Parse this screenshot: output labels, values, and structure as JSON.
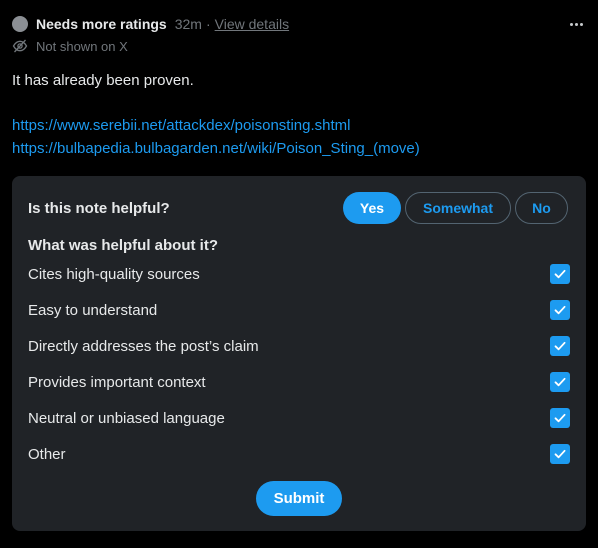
{
  "header": {
    "status": "Needs more ratings",
    "time": "32m",
    "separator": "·",
    "details_link": "View details",
    "sub_status": "Not shown on X"
  },
  "note": {
    "text": "It has already been proven.",
    "links": [
      "https://www.serebii.net/attackdex/poisonsting.shtml",
      "https://bulbapedia.bulbagarden.net/wiki/Poison_Sting_(move)"
    ]
  },
  "rating": {
    "question": "Is this note helpful?",
    "options": {
      "yes": "Yes",
      "somewhat": "Somewhat",
      "no": "No"
    },
    "selected": "Yes",
    "helpful_question": "What was helpful about it?",
    "reasons": [
      {
        "label": "Cites high-quality sources",
        "checked": true
      },
      {
        "label": "Easy to understand",
        "checked": true
      },
      {
        "label": "Directly addresses the post’s claim",
        "checked": true
      },
      {
        "label": "Provides important context",
        "checked": true
      },
      {
        "label": "Neutral or unbiased language",
        "checked": true
      },
      {
        "label": "Other",
        "checked": true
      }
    ],
    "submit": "Submit"
  },
  "colors": {
    "accent": "#1d9bf0",
    "panel": "#202327",
    "muted": "#71767b",
    "status_dot": "#8b8f94"
  },
  "icons": [
    "status-dot",
    "more-icon",
    "eye-off-icon",
    "checkmark-icon"
  ]
}
